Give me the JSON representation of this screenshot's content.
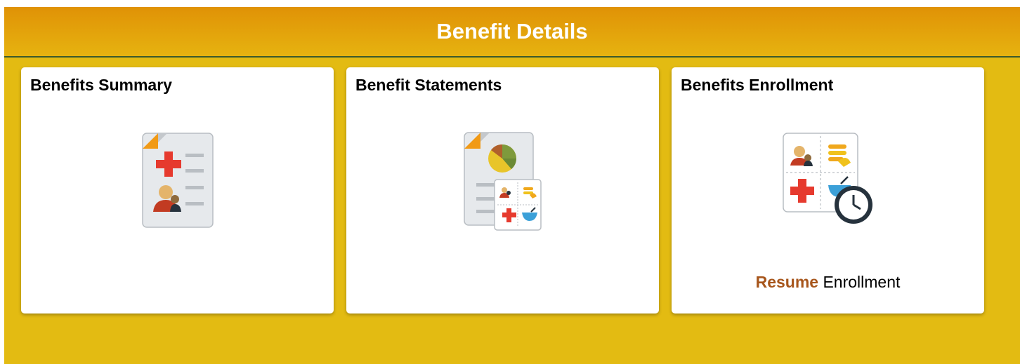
{
  "page": {
    "title": "Benefit Details"
  },
  "tiles": [
    {
      "title": "Benefits Summary",
      "icon": "benefits-summary-icon"
    },
    {
      "title": "Benefit Statements",
      "icon": "benefit-statements-icon"
    },
    {
      "title": "Benefits Enrollment",
      "icon": "benefits-enrollment-icon",
      "status_emphasis": "Resume",
      "status_text": "Enrollment"
    }
  ],
  "colors": {
    "header_gradient_top": "#e09206",
    "header_gradient_bottom": "#e6b310",
    "background": "#e3bb12",
    "tile": "#ffffff",
    "resume_accent": "#a7561c"
  }
}
